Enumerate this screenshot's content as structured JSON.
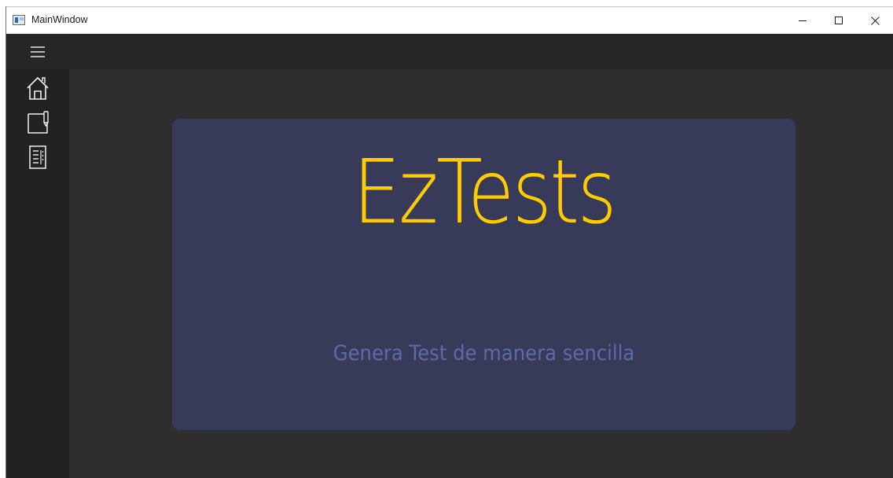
{
  "window": {
    "title": "MainWindow",
    "controls": {
      "minimize_icon": "minimize-icon",
      "maximize_icon": "maximize-icon",
      "close_icon": "close-icon"
    }
  },
  "sidebar": {
    "items": [
      {
        "icon": "hamburger-menu-icon"
      },
      {
        "icon": "home-icon"
      },
      {
        "icon": "edit-test-icon"
      },
      {
        "icon": "list-document-icon"
      }
    ]
  },
  "main": {
    "title": "EzTests",
    "subtitle": "Genera Test de manera sencilla"
  },
  "colors": {
    "accent": "#ffcc00",
    "card_background": "#383a59",
    "subtitle": "#5d6aa6",
    "window_background": "#2d2d2d",
    "sidebar_background": "#222222"
  }
}
